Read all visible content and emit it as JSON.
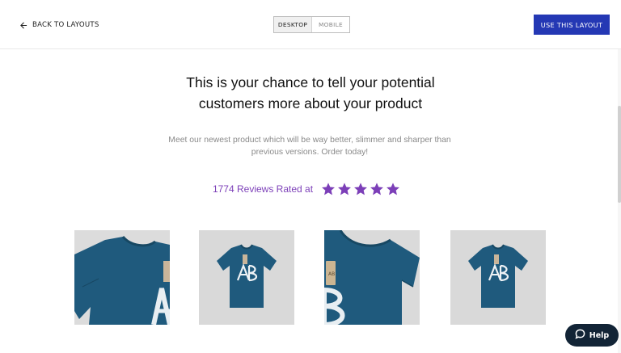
{
  "header": {
    "back_label": "BACK TO LAYOUTS",
    "view_toggle": {
      "options": [
        "DESKTOP",
        "MOBILE"
      ],
      "selected": "DESKTOP"
    },
    "cta_label": "USE THIS LAYOUT"
  },
  "hero": {
    "headline_line1": "This is your chance to tell your potential",
    "headline_line2": "customers more about your product",
    "subtext_line1": "Meet our newest product which will be way better, slimmer and sharper than",
    "subtext_line2": "previous versions. Order today!",
    "reviews_text": "1774 Reviews Rated at",
    "rating": 5,
    "rating_max": 5
  },
  "colors": {
    "accent_purple": "#7c3fb8",
    "cta_blue": "#2438b4",
    "shirt_blue": "#1f5a7d",
    "help_bg": "#122436"
  },
  "products": [
    {
      "icon": "tshirt-closeup-left-icon"
    },
    {
      "icon": "tshirt-front-logo-icon"
    },
    {
      "icon": "tshirt-closeup-tag-icon"
    },
    {
      "icon": "tshirt-front-logo-icon"
    }
  ],
  "help": {
    "label": "Help",
    "icon": "chat-bubble-icon"
  }
}
